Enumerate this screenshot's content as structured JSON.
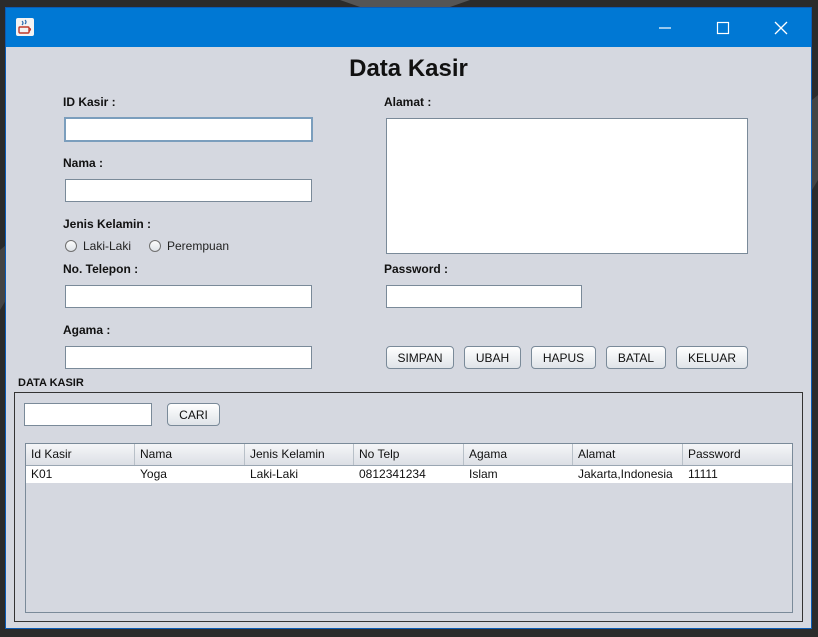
{
  "window": {
    "title_icon": "java-icon",
    "minimize_icon": "minimize-icon",
    "maximize_icon": "maximize-icon",
    "close_icon": "close-icon"
  },
  "form": {
    "title": "Data Kasir",
    "id_kasir_label": "ID Kasir :",
    "id_kasir_value": "",
    "nama_label": "Nama :",
    "nama_value": "",
    "jenis_kelamin_label": "Jenis Kelamin :",
    "radio_laki": "Laki-Laki",
    "radio_perempuan": "Perempuan",
    "telepon_label": "No. Telepon :",
    "telepon_value": "",
    "agama_label": "Agama :",
    "agama_value": "",
    "alamat_label": "Alamat :",
    "alamat_value": "",
    "password_label": "Password :",
    "password_value": ""
  },
  "actions": {
    "simpan": "SIMPAN",
    "ubah": "UBAH",
    "hapus": "HAPUS",
    "batal": "BATAL",
    "keluar": "KELUAR"
  },
  "section": {
    "title": "DATA KASIR",
    "search_value": "",
    "search_button": "CARI"
  },
  "table": {
    "columns": [
      "Id Kasir",
      "Nama",
      "Jenis Kelamin",
      "No Telp",
      "Agama",
      "Alamat",
      "Password"
    ],
    "rows": [
      [
        "K01",
        "Yoga",
        "Laki-Laki",
        "0812341234",
        "Islam",
        "Jakarta,Indonesia",
        "11111"
      ]
    ]
  },
  "colors": {
    "titlebar": "#0078d4",
    "window_bg": "#d5d8e0"
  }
}
